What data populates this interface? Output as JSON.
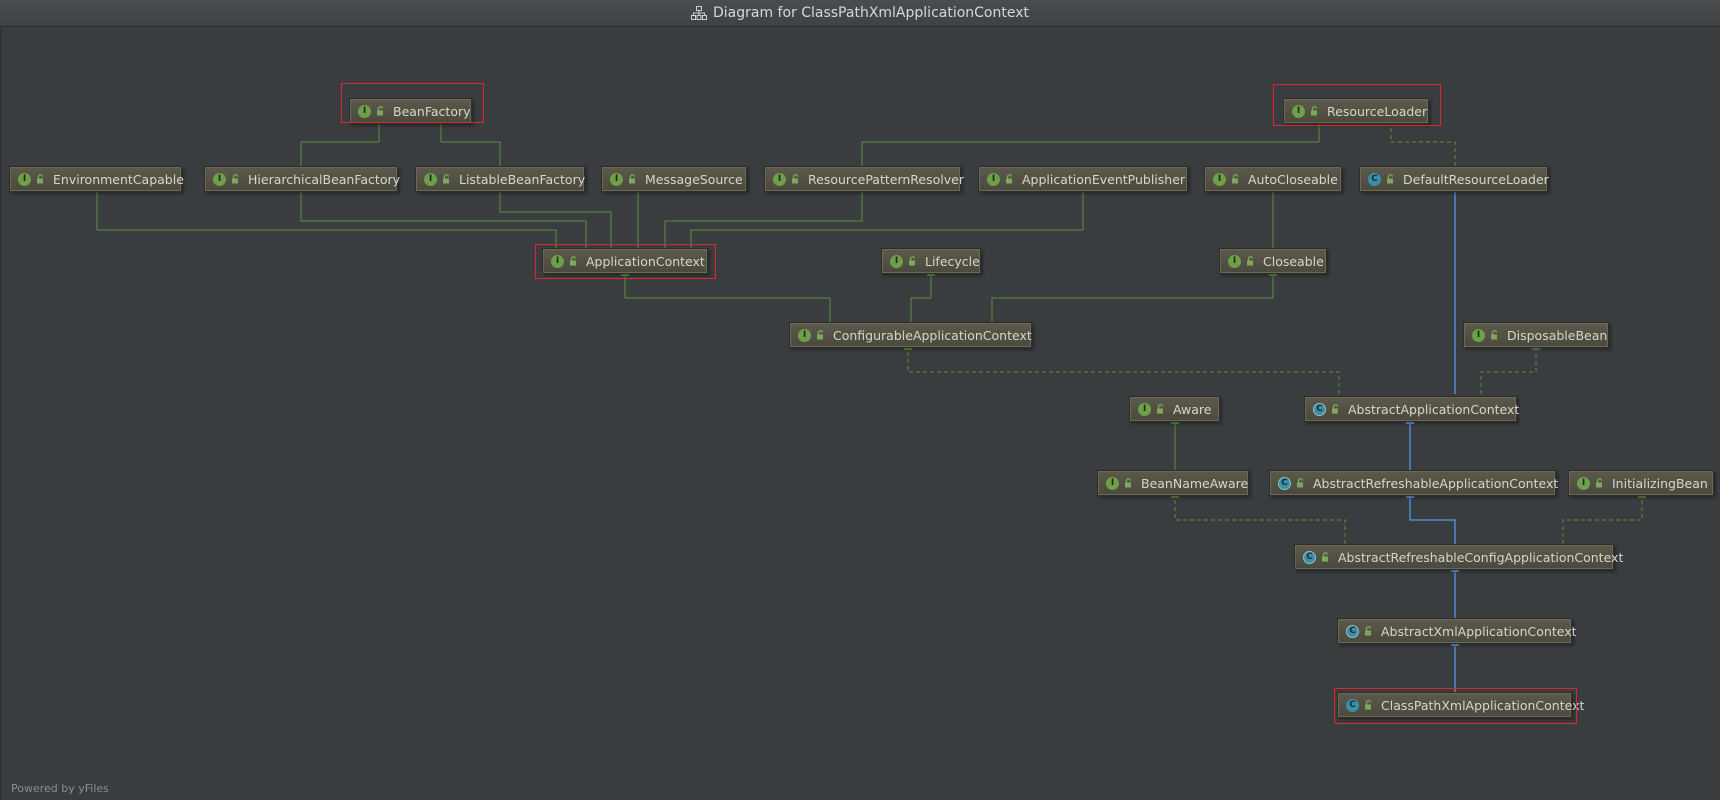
{
  "window": {
    "title": "Diagram for ClassPathXmlApplicationContext",
    "title_icon": "diagram-icon"
  },
  "colors": {
    "background": "#3a3d40",
    "node_fill": "#514f42",
    "interface_badge": "#6e9f4a",
    "class_badge": "#3b8fa8",
    "implements_edge": "#5b8f3c",
    "extends_edge": "#5b95e6",
    "highlight": "#e0262a"
  },
  "nodes": {
    "BeanFactory": {
      "label": "BeanFactory",
      "kind": "interface",
      "badge": "I"
    },
    "ResourceLoader": {
      "label": "ResourceLoader",
      "kind": "interface",
      "badge": "I"
    },
    "EnvironmentCapable": {
      "label": "EnvironmentCapable",
      "kind": "interface",
      "badge": "I"
    },
    "HierarchicalBeanFactory": {
      "label": "HierarchicalBeanFactory",
      "kind": "interface",
      "badge": "I"
    },
    "ListableBeanFactory": {
      "label": "ListableBeanFactory",
      "kind": "interface",
      "badge": "I"
    },
    "MessageSource": {
      "label": "MessageSource",
      "kind": "interface",
      "badge": "I"
    },
    "ResourcePatternResolver": {
      "label": "ResourcePatternResolver",
      "kind": "interface",
      "badge": "I"
    },
    "ApplicationEventPublisher": {
      "label": "ApplicationEventPublisher",
      "kind": "interface",
      "badge": "I"
    },
    "AutoCloseable": {
      "label": "AutoCloseable",
      "kind": "interface",
      "badge": "I"
    },
    "DefaultResourceLoader": {
      "label": "DefaultResourceLoader",
      "kind": "class",
      "badge": "C"
    },
    "ApplicationContext": {
      "label": "ApplicationContext",
      "kind": "interface",
      "badge": "I"
    },
    "Lifecycle": {
      "label": "Lifecycle",
      "kind": "interface",
      "badge": "I"
    },
    "Closeable": {
      "label": "Closeable",
      "kind": "interface",
      "badge": "I"
    },
    "ConfigurableApplicationContext": {
      "label": "ConfigurableApplicationContext",
      "kind": "interface",
      "badge": "I"
    },
    "DisposableBean": {
      "label": "DisposableBean",
      "kind": "interface",
      "badge": "I"
    },
    "Aware": {
      "label": "Aware",
      "kind": "interface",
      "badge": "I"
    },
    "AbstractApplicationContext": {
      "label": "AbstractApplicationContext",
      "kind": "abstract",
      "badge": "C"
    },
    "BeanNameAware": {
      "label": "BeanNameAware",
      "kind": "interface",
      "badge": "I"
    },
    "AbstractRefreshableApplicationContext": {
      "label": "AbstractRefreshableApplicationContext",
      "kind": "abstract",
      "badge": "C"
    },
    "InitializingBean": {
      "label": "InitializingBean",
      "kind": "interface",
      "badge": "I"
    },
    "AbstractRefreshableConfigApplicationContext": {
      "label": "AbstractRefreshableConfigApplicationContext",
      "kind": "abstract",
      "badge": "C"
    },
    "AbstractXmlApplicationContext": {
      "label": "AbstractXmlApplicationContext",
      "kind": "abstract",
      "badge": "C"
    },
    "ClassPathXmlApplicationContext": {
      "label": "ClassPathXmlApplicationContext",
      "kind": "class",
      "badge": "C"
    }
  },
  "highlighted": [
    "BeanFactory",
    "ResourceLoader",
    "ApplicationContext",
    "ClassPathXmlApplicationContext"
  ],
  "footer": "Powered by yFiles"
}
